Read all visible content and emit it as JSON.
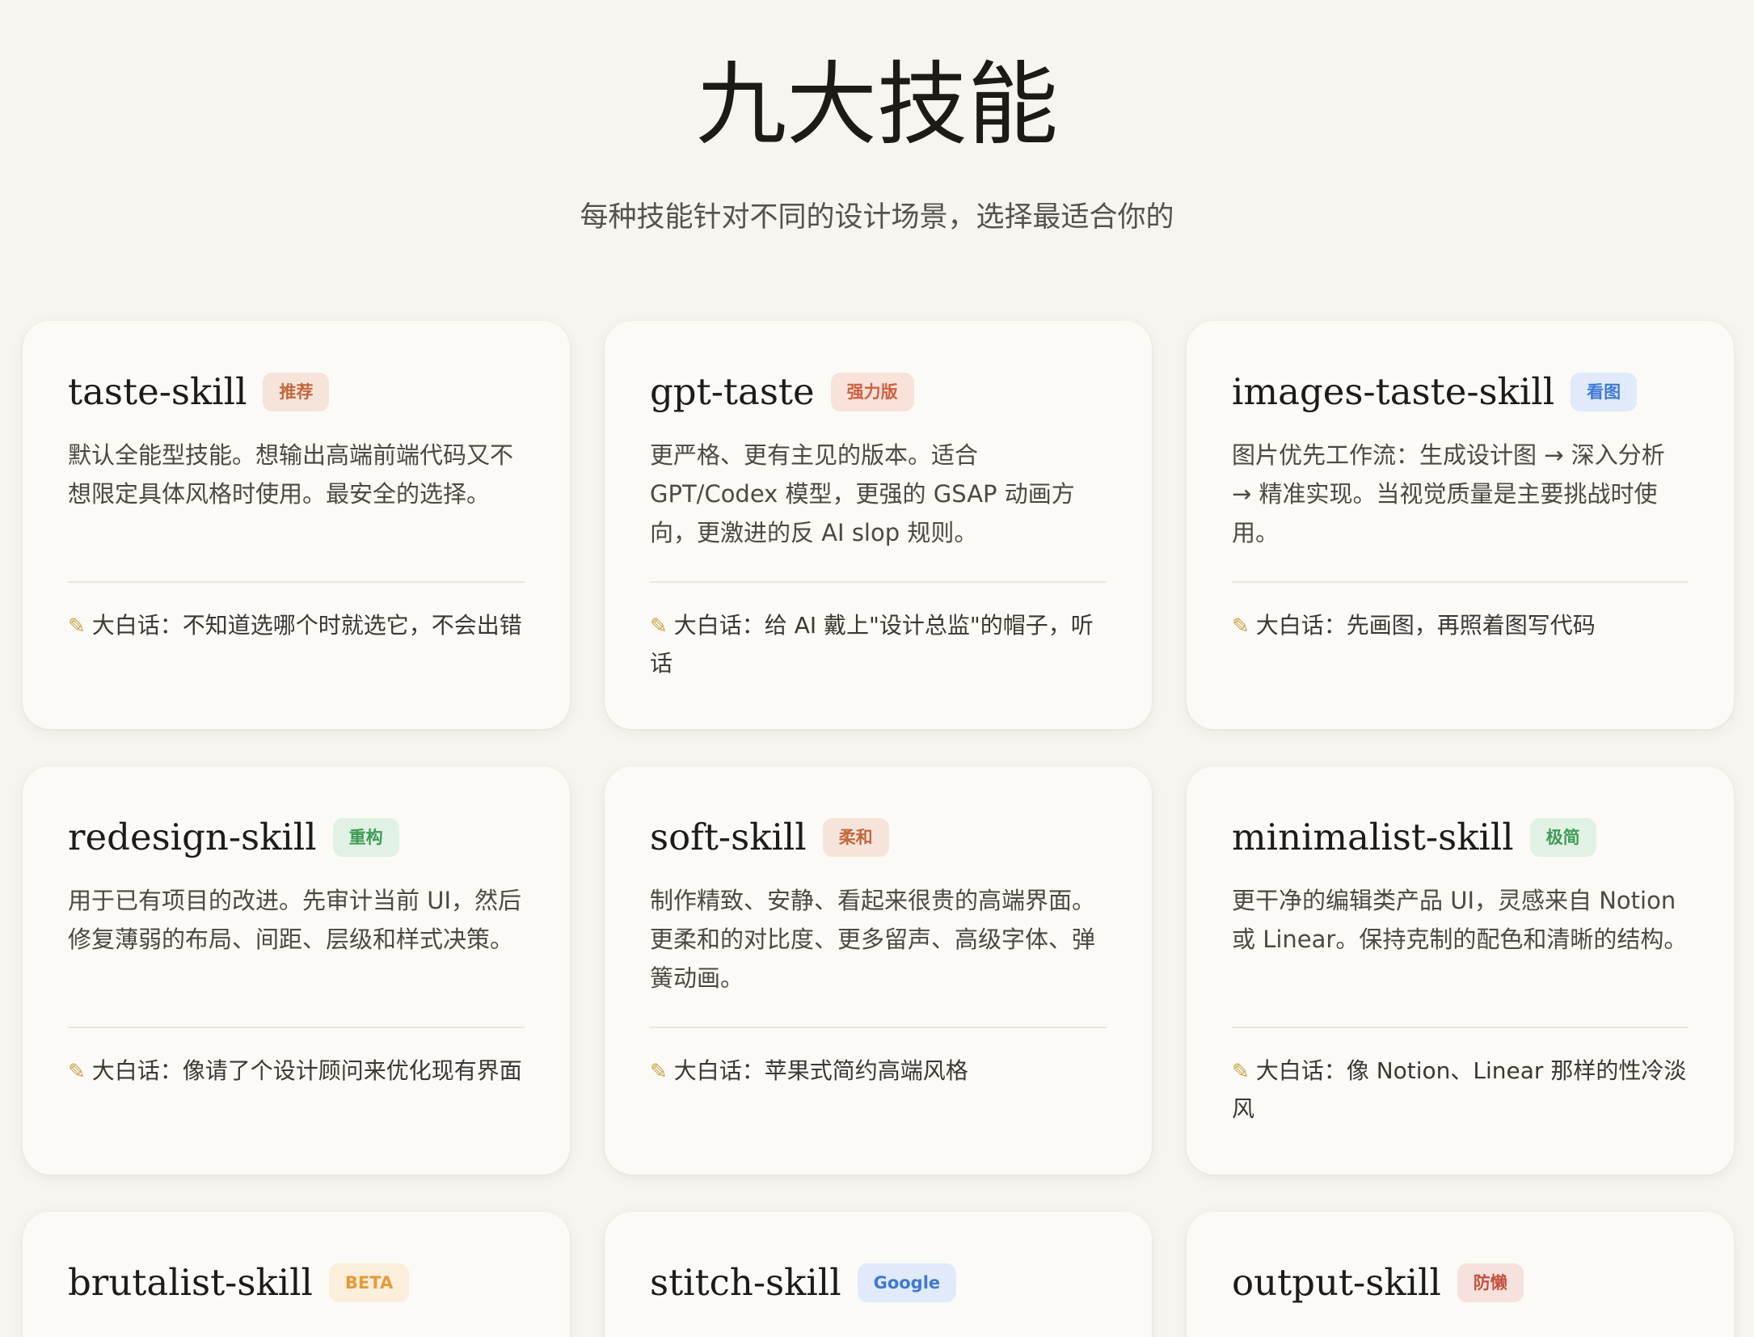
{
  "header": {
    "title": "九大技能",
    "subtitle": "每种技能针对不同的设计场景，选择最适合你的"
  },
  "skills": [
    {
      "name": "taste-skill",
      "badge": "推荐",
      "badge_color": "#c4673d",
      "badge_bg": "#f6e4da",
      "description": "默认全能型技能。想输出高端前端代码又不想限定具体风格时使用。最安全的选择。",
      "note": "大白话：不知道选哪个时就选它，不会出错"
    },
    {
      "name": "gpt-taste",
      "badge": "强力版",
      "badge_color": "#d0603e",
      "badge_bg": "#f8e2da",
      "description": "更严格、更有主见的版本。适合 GPT/Codex 模型，更强的 GSAP 动画方向，更激进的反 AI slop 规则。",
      "note": "大白话：给 AI 戴上\"设计总监\"的帽子，听话"
    },
    {
      "name": "images-taste-skill",
      "badge": "看图",
      "badge_color": "#3f79d4",
      "badge_bg": "#e0eafa",
      "description": "图片优先工作流：生成设计图 → 深入分析 → 精准实现。当视觉质量是主要挑战时使用。",
      "note": "大白话：先画图，再照着图写代码"
    },
    {
      "name": "redesign-skill",
      "badge": "重构",
      "badge_color": "#3f9a57",
      "badge_bg": "#e1f2e4",
      "description": "用于已有项目的改进。先审计当前 UI，然后修复薄弱的布局、间距、层级和样式决策。",
      "note": "大白话：像请了个设计顾问来优化现有界面"
    },
    {
      "name": "soft-skill",
      "badge": "柔和",
      "badge_color": "#c4673d",
      "badge_bg": "#f6e4da",
      "description": "制作精致、安静、看起来很贵的高端界面。更柔和的对比度、更多留声、高级字体、弹簧动画。",
      "note": "大白话：苹果式简约高端风格"
    },
    {
      "name": "minimalist-skill",
      "badge": "极简",
      "badge_color": "#3f9a57",
      "badge_bg": "#e1f2e4",
      "description": "更干净的编辑类产品 UI，灵感来自 Notion 或 Linear。保持克制的配色和清晰的结构。",
      "note": "大白话：像 Notion、Linear 那样的性冷淡风"
    },
    {
      "name": "brutalist-skill",
      "badge": "BETA",
      "badge_color": "#e59a3a",
      "badge_bg": "#fbeedb",
      "description": "",
      "note": ""
    },
    {
      "name": "stitch-skill",
      "badge": "Google",
      "badge_color": "#3f79d4",
      "badge_bg": "#e0eafa",
      "description": "",
      "note": ""
    },
    {
      "name": "output-skill",
      "badge": "防懒",
      "badge_color": "#c4503e",
      "badge_bg": "#f6e1dc",
      "description": "",
      "note": ""
    }
  ]
}
